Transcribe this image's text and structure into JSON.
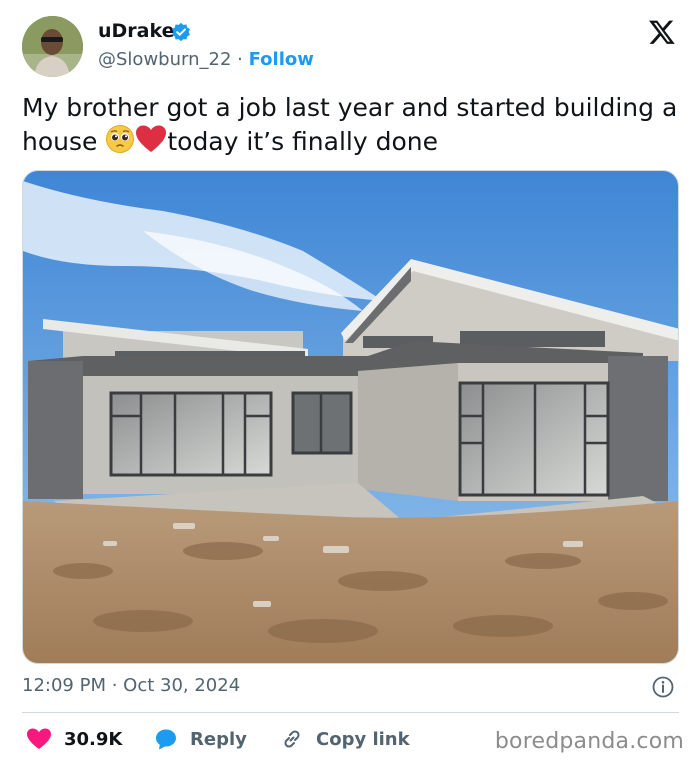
{
  "author": {
    "display_name": "uDrake",
    "handle": "@Slowburn_22",
    "separator": "·",
    "follow_label": "Follow",
    "verified": true
  },
  "tweet": {
    "text_part1": "My brother got a job last year and started building a house",
    "text_part2": "today it’s finally done",
    "emojis": [
      "pleading-face-emoji",
      "red-heart-emoji"
    ]
  },
  "media": {
    "type": "photo",
    "subject": "single-storey grey house with dirt yard under blue sky"
  },
  "meta": {
    "timestamp": "12:09 PM · Oct 30, 2024"
  },
  "actions": {
    "like_count": "30.9K",
    "reply_label": "Reply",
    "copy_link_label": "Copy link"
  },
  "watermark": "boredpanda.com",
  "colors": {
    "accent": "#1d9bf0",
    "like": "#f91880",
    "muted": "#536471",
    "text": "#0f1419"
  }
}
